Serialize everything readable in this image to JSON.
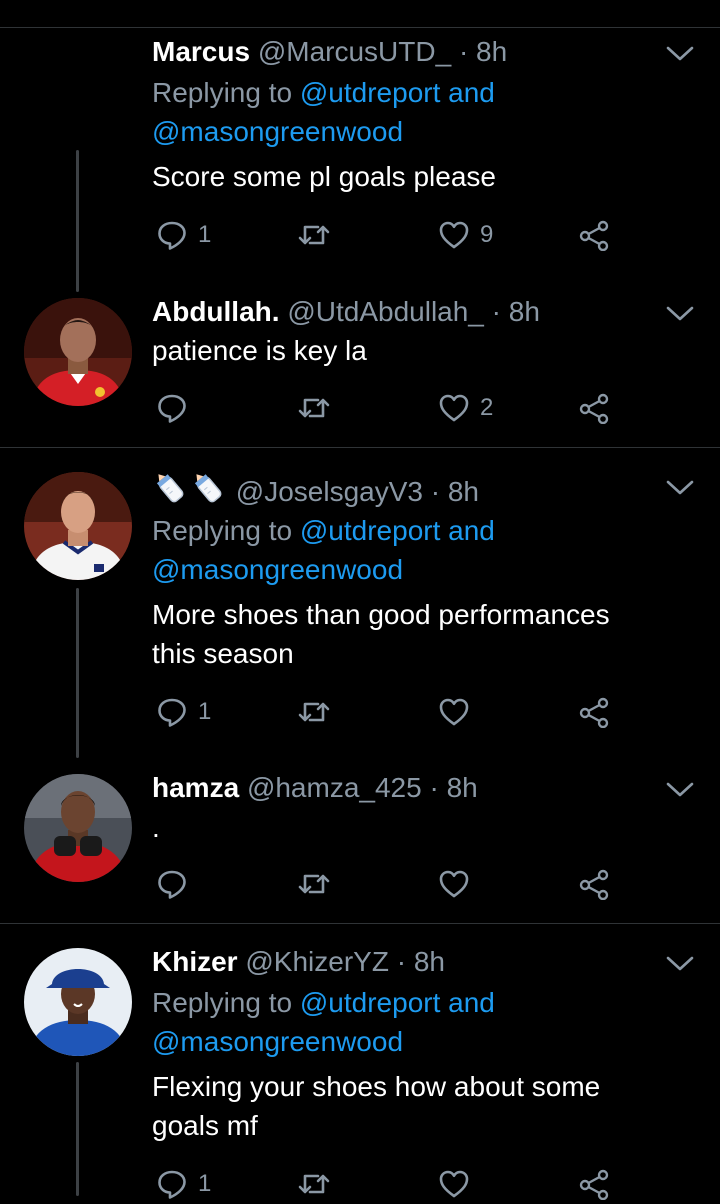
{
  "tweets": [
    {
      "name": "Marcus",
      "handle": "@MarcusUTD_",
      "time": "· 8h",
      "replying_prefix": "Replying to ",
      "replying_mentions": "@utdreport and",
      "replying_mentions2": "@masongreenwood",
      "body": "Score some pl goals please",
      "reply_count": "1",
      "retweet_count": "",
      "like_count": "9"
    },
    {
      "name": "Abdullah.",
      "handle": "@UtdAbdullah_",
      "time": "· 8h",
      "body": "patience is key la",
      "reply_count": "",
      "retweet_count": "",
      "like_count": "2"
    },
    {
      "name": "🍼🍼",
      "handle": "@JoselsgayV3",
      "time": "· 8h",
      "replying_prefix": "Replying to ",
      "replying_mentions": "@utdreport and",
      "replying_mentions2": "@masongreenwood",
      "body_line1": "More shoes than good performances",
      "body_line2": "this season",
      "reply_count": "1",
      "retweet_count": "",
      "like_count": ""
    },
    {
      "name": "hamza",
      "handle": "@hamza_425",
      "time": "· 8h",
      "body": ".",
      "reply_count": "",
      "retweet_count": "",
      "like_count": ""
    },
    {
      "name": "Khizer",
      "handle": "@KhizerYZ",
      "time": "· 8h",
      "replying_prefix": "Replying to ",
      "replying_mentions": "@utdreport and",
      "replying_mentions2": "@masongreenwood",
      "body_line1": "Flexing your shoes how about some",
      "body_line2": "goals mf",
      "reply_count": "1",
      "retweet_count": "",
      "like_count": ""
    }
  ],
  "colors": {
    "background": "#000000",
    "text": "#ffffff",
    "secondary": "#8b98a5",
    "mention": "#1d9bf0",
    "divider": "#2f3336"
  },
  "icons": [
    "reply-icon",
    "retweet-icon",
    "like-icon",
    "share-icon",
    "chevron-down-icon"
  ]
}
